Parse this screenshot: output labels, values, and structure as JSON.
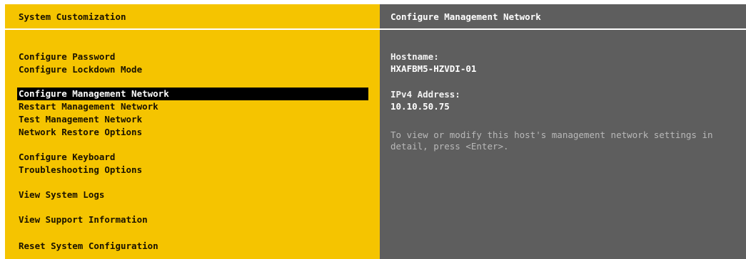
{
  "left_pane": {
    "title": "System Customization",
    "menu": [
      {
        "label": "Configure Password"
      },
      {
        "label": "Configure Lockdown Mode"
      },
      {
        "label": "Configure Management Network",
        "selected": true
      },
      {
        "label": "Restart Management Network"
      },
      {
        "label": "Test Management Network"
      },
      {
        "label": "Network Restore Options"
      },
      {
        "label": "Configure Keyboard"
      },
      {
        "label": "Troubleshooting Options"
      },
      {
        "label": "View System Logs"
      },
      {
        "label": "View Support Information"
      },
      {
        "label": "Reset System Configuration"
      }
    ]
  },
  "right_pane": {
    "title": "Configure Management Network",
    "hostname_label": "Hostname:",
    "hostname_value": "HXAFBM5-HZVDI-01",
    "ipv4_label": "IPv4 Address:",
    "ipv4_value": "10.10.50.75",
    "help_line1": "To view or modify this host's management network settings in",
    "help_line2": "detail, press <Enter>."
  },
  "colors": {
    "left_background": "#f5c400",
    "right_background": "#5e5e5e",
    "selection_background": "#000000"
  }
}
